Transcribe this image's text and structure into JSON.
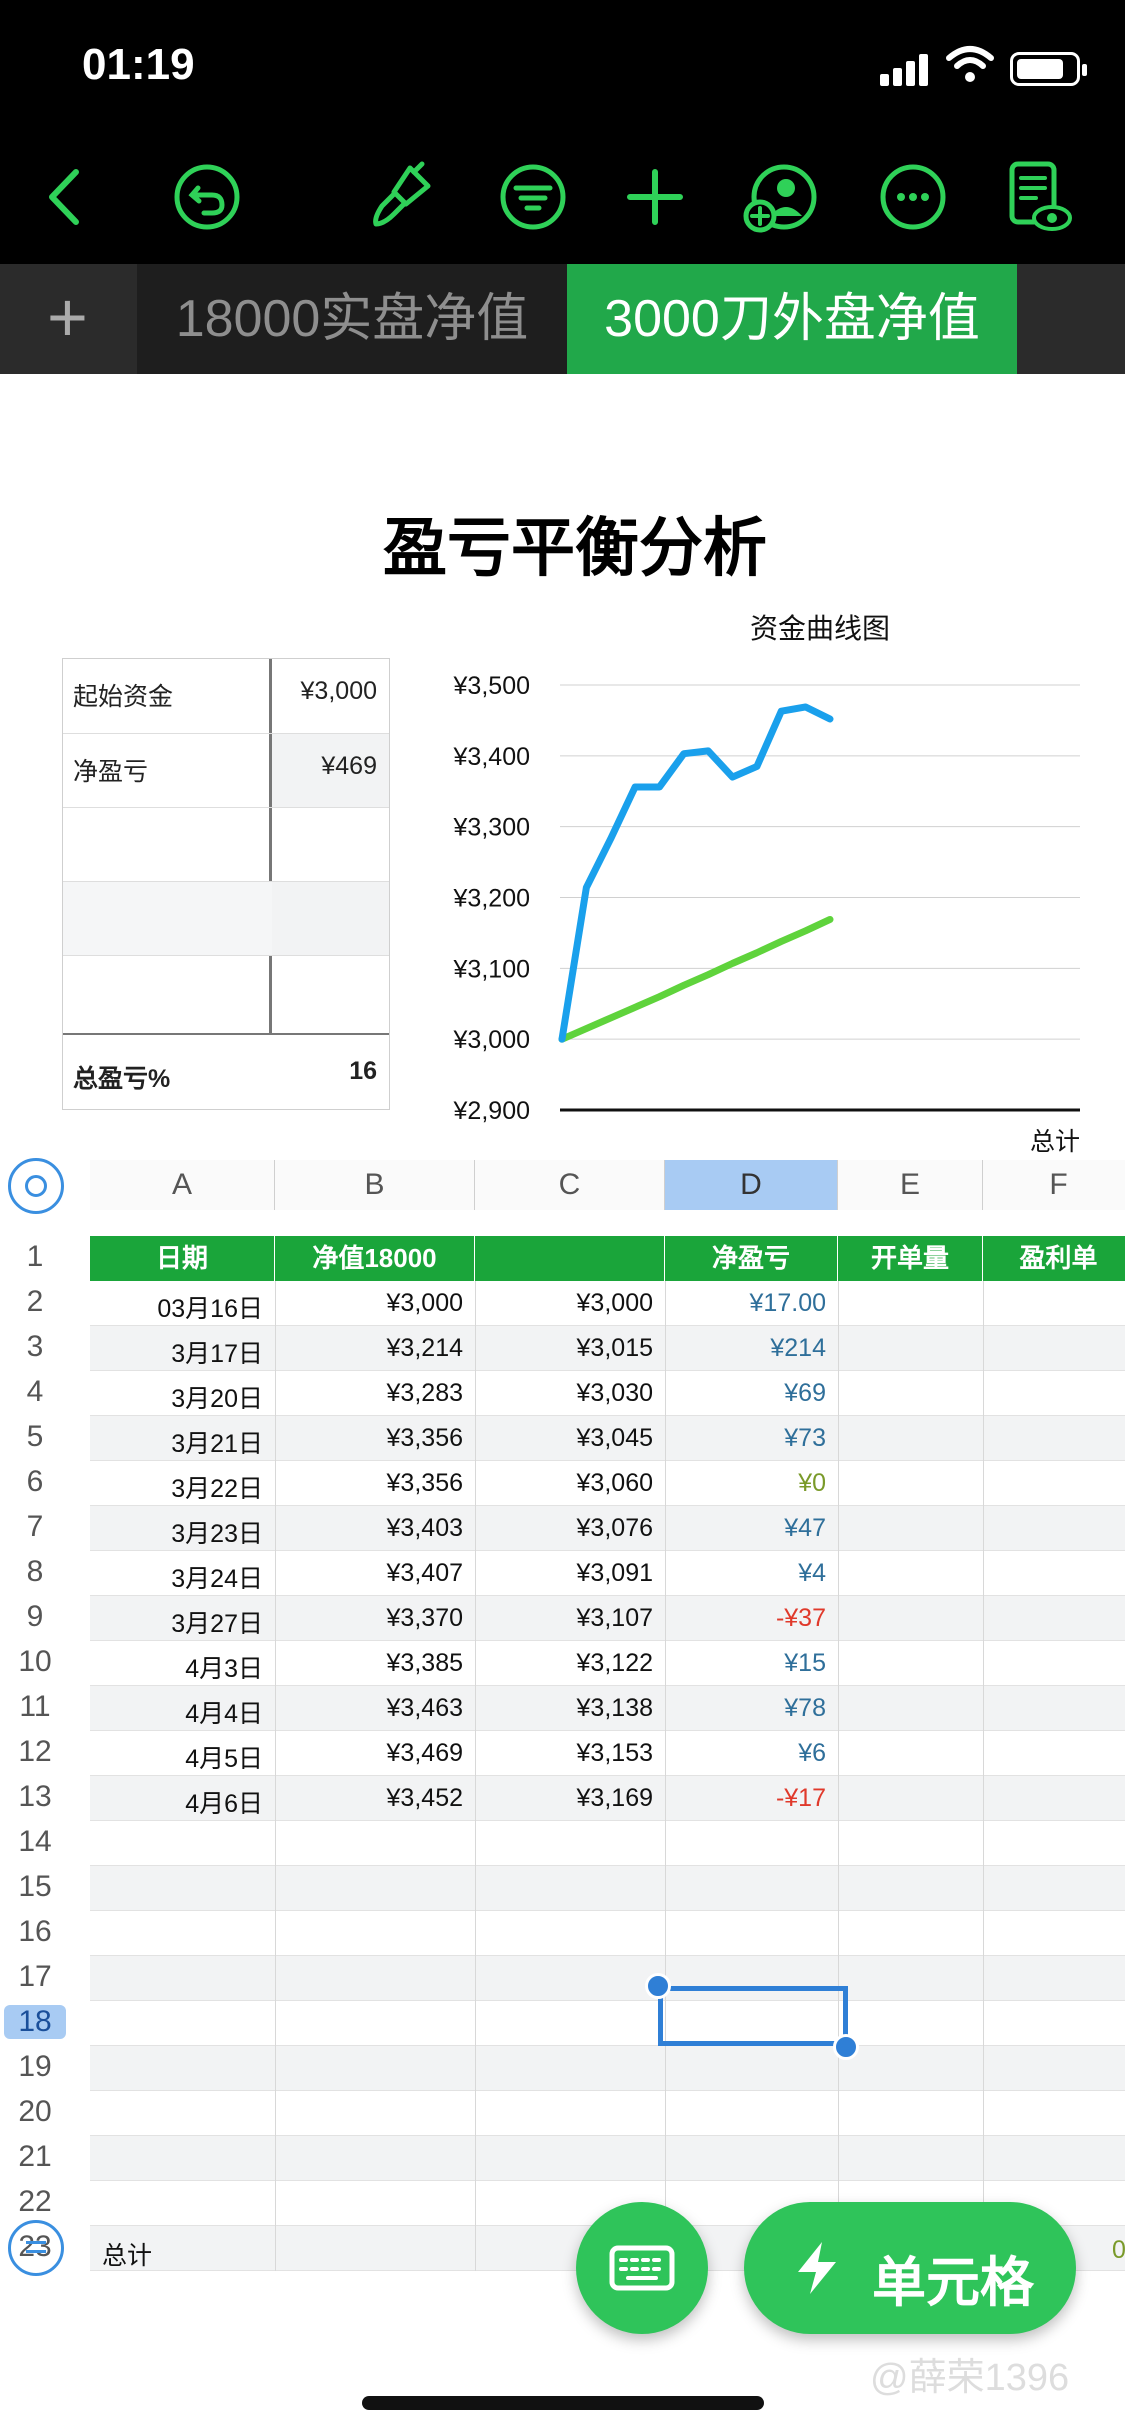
{
  "status": {
    "time": "01:19"
  },
  "toolbar": {
    "icons": [
      "back-icon",
      "undo-icon",
      "paintbrush-icon",
      "filter-icon",
      "add-icon",
      "collaborate-icon",
      "more-icon",
      "reader-mode-icon"
    ],
    "accent": "#2fd158"
  },
  "tabs": {
    "add": "+",
    "items": [
      {
        "label": "18000实盘净值",
        "active": false
      },
      {
        "label": "3000刀外盘净值",
        "active": true
      }
    ]
  },
  "title": "盈亏平衡分析",
  "summary": {
    "rows": [
      {
        "label": "起始资金",
        "value": "¥3,000"
      },
      {
        "label": "净盈亏",
        "value": "¥469"
      },
      {
        "label": "",
        "value": ""
      },
      {
        "label": "",
        "value": ""
      },
      {
        "label": "",
        "value": ""
      }
    ],
    "footer": {
      "label": "总盈亏%",
      "value": "16"
    }
  },
  "chart_data": {
    "type": "line",
    "title": "资金曲线图",
    "xlabel": "总计",
    "y_ticks": [
      "¥3,500",
      "¥3,400",
      "¥3,300",
      "¥3,200",
      "¥3,100",
      "¥3,000",
      "¥2,900"
    ],
    "ylim": [
      2900,
      3500
    ],
    "x": [
      "03月16日",
      "3月17日",
      "3月20日",
      "3月21日",
      "3月22日",
      "3月23日",
      "3月24日",
      "3月27日",
      "4月3日",
      "4月4日",
      "4月5日",
      "4月6日"
    ],
    "series": [
      {
        "values": [
          3000,
          3214,
          3283,
          3356,
          3356,
          3403,
          3407,
          3370,
          3385,
          3463,
          3469,
          3452
        ],
        "color": "#1aa0ec"
      },
      {
        "values": [
          3000,
          3015,
          3030,
          3045,
          3060,
          3076,
          3091,
          3107,
          3122,
          3138,
          3153,
          3169
        ],
        "color": "#5fd33c"
      }
    ],
    "grid": true
  },
  "grid": {
    "columns": [
      "A",
      "B",
      "C",
      "D",
      "E",
      "F"
    ],
    "selected_column": "D",
    "headers": [
      "日期",
      "净值18000",
      "",
      "净盈亏",
      "开单量",
      "盈利单"
    ],
    "rows": [
      [
        "03月16日",
        "¥3,000",
        "¥3,000",
        "¥17.00"
      ],
      [
        "3月17日",
        "¥3,214",
        "¥3,015",
        "¥214"
      ],
      [
        "3月20日",
        "¥3,283",
        "¥3,030",
        "¥69"
      ],
      [
        "3月21日",
        "¥3,356",
        "¥3,045",
        "¥73"
      ],
      [
        "3月22日",
        "¥3,356",
        "¥3,060",
        "¥0"
      ],
      [
        "3月23日",
        "¥3,403",
        "¥3,076",
        "¥47"
      ],
      [
        "3月24日",
        "¥3,407",
        "¥3,091",
        "¥4"
      ],
      [
        "3月27日",
        "¥3,370",
        "¥3,107",
        "-¥37"
      ],
      [
        "4月3日",
        "¥3,385",
        "¥3,122",
        "¥15"
      ],
      [
        "4月4日",
        "¥3,463",
        "¥3,138",
        "¥78"
      ],
      [
        "4月5日",
        "¥3,469",
        "¥3,153",
        "¥6"
      ],
      [
        "4月6日",
        "¥3,452",
        "¥3,169",
        "-¥17"
      ]
    ],
    "row_numbers": [
      "1",
      "2",
      "3",
      "4",
      "5",
      "6",
      "7",
      "8",
      "9",
      "10",
      "11",
      "12",
      "13",
      "14",
      "15",
      "16",
      "17",
      "18",
      "19",
      "20",
      "21",
      "22",
      "23"
    ],
    "selected_row": "18",
    "total_label": "总计",
    "total_partial": "0",
    "colors": {
      "header": "#1aa53a",
      "positive": "#2f6f9a",
      "negative": "#e0392b",
      "zero": "#7a9a2a"
    }
  },
  "buttons": {
    "keyboard_icon": "keyboard-icon",
    "cell_icon": "bolt-icon",
    "cell_label": "单元格"
  },
  "watermark": "@薛荣1396"
}
